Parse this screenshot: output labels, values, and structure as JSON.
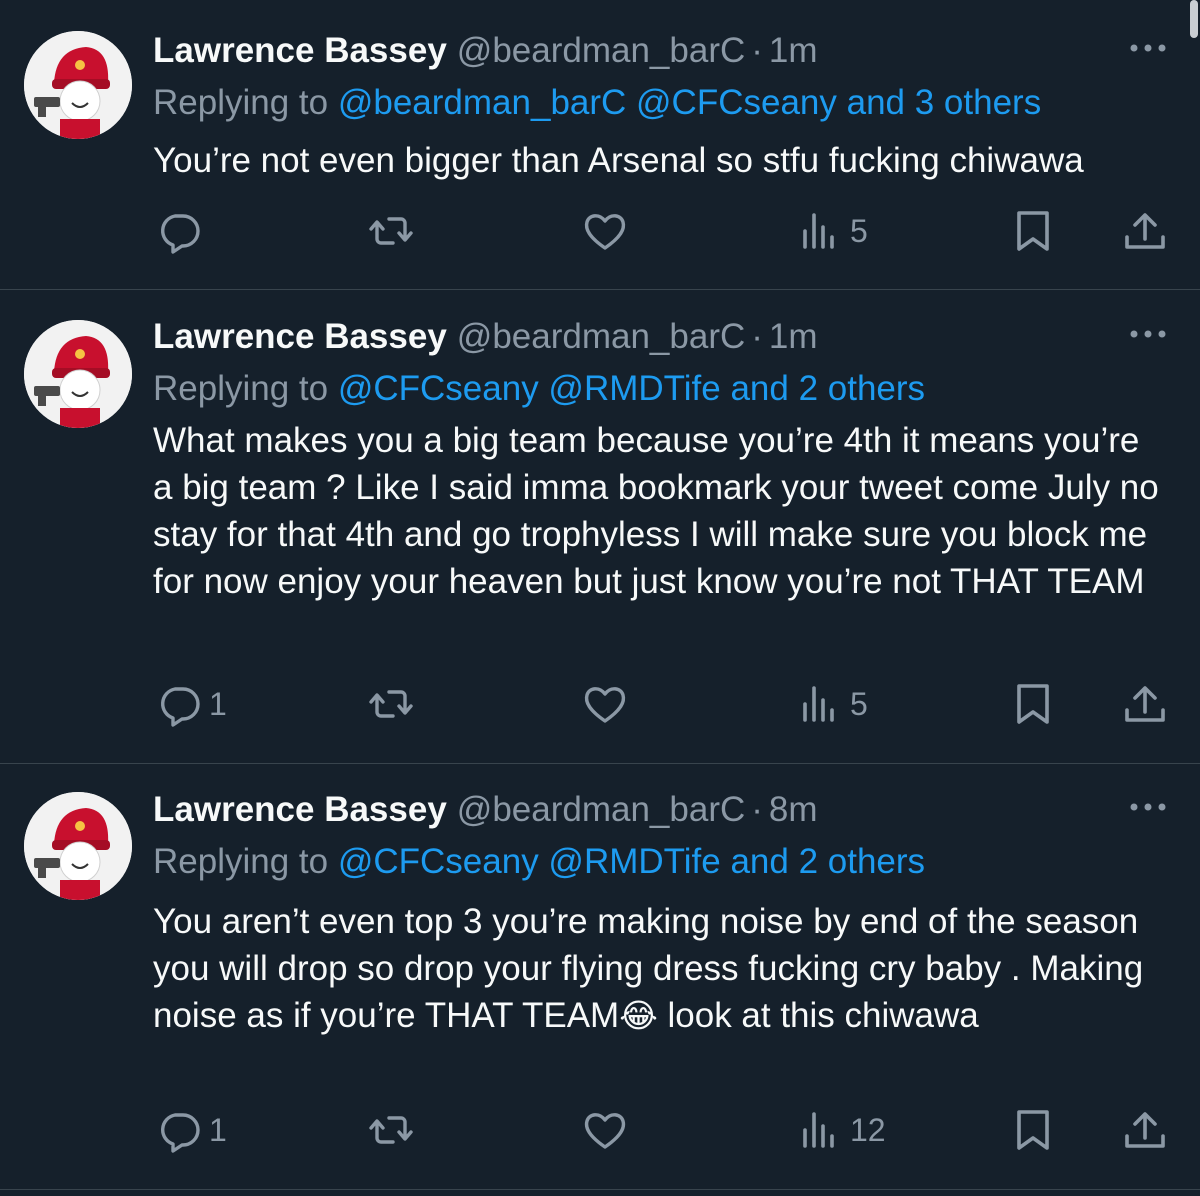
{
  "tweets": [
    {
      "author_name": "Lawrence Bassey",
      "handle": "@beardman_barC",
      "dot": "·",
      "time": "1m",
      "replying_prefix": "Replying to",
      "replying_mentions": "@beardman_barC @CFCseany",
      "replying_others": "and 3 others",
      "text": "You’re not even bigger than Arsenal so stfu fucking chiwawa",
      "reply_count": "",
      "retweet_count": "",
      "like_count": "",
      "views_count": "5"
    },
    {
      "author_name": "Lawrence Bassey",
      "handle": "@beardman_barC",
      "dot": "·",
      "time": "1m",
      "replying_prefix": "Replying to",
      "replying_mentions": "@CFCseany @RMDTife",
      "replying_others": "and 2 others",
      "text": "What makes you a big team because you’re 4th it means you’re a big team ? Like I said imma bookmark your tweet come July no stay for that 4th and go trophyless I will make sure you block me for now enjoy your heaven but just know you’re not THAT TEAM",
      "reply_count": "1",
      "retweet_count": "",
      "like_count": "",
      "views_count": "5"
    },
    {
      "author_name": "Lawrence Bassey",
      "handle": "@beardman_barC",
      "dot": "·",
      "time": "8m",
      "replying_prefix": "Replying to",
      "replying_mentions": "@CFCseany @RMDTife",
      "replying_others": "and 2 others",
      "text_before_emoji": "You aren’t even top 3 you’re making noise by end of the season you will drop so drop your flying dress fucking cry baby . Making noise as if you’re THAT TEAM",
      "emoji": "😂",
      "text_after_emoji": " look at this chiwawa",
      "reply_count": "1",
      "retweet_count": "",
      "like_count": "",
      "views_count": "12"
    }
  ],
  "icons": {
    "more": "more-horizontal-icon",
    "reply": "reply-bubble-icon",
    "retweet": "retweet-arrows-icon",
    "like": "heart-icon",
    "views": "bar-chart-icon",
    "bookmark": "bookmark-icon",
    "share": "share-upload-icon"
  },
  "colors": {
    "background": "#15202b",
    "text": "#f7f9f9",
    "secondary": "#8b98a5",
    "link": "#1d9bf0",
    "divider": "#38444d"
  }
}
